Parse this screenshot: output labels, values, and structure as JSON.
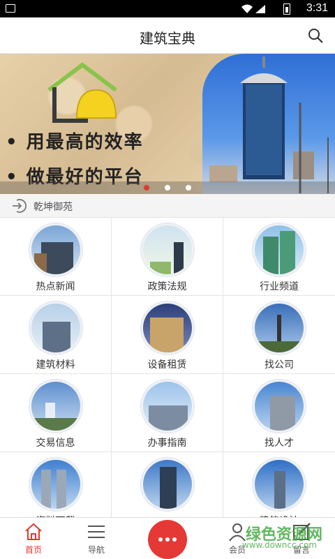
{
  "status_bar": {
    "time": "3:31"
  },
  "app_bar": {
    "title": "建筑宝典"
  },
  "banner": {
    "line1": "• 用最高的效率",
    "line2": "• 做最好的平台",
    "page_count": 3,
    "active_page": 1
  },
  "section": {
    "label": "乾坤御苑"
  },
  "grid": {
    "items": [
      {
        "label": "热点新闻",
        "icon": "news-building-icon"
      },
      {
        "label": "政策法规",
        "icon": "policy-icon"
      },
      {
        "label": "行业频道",
        "icon": "industry-icon"
      },
      {
        "label": "建筑材料",
        "icon": "materials-icon"
      },
      {
        "label": "设备租赁",
        "icon": "equipment-icon"
      },
      {
        "label": "找公司",
        "icon": "company-icon"
      },
      {
        "label": "交易信息",
        "icon": "trade-icon"
      },
      {
        "label": "办事指南",
        "icon": "guide-icon"
      },
      {
        "label": "找人才",
        "icon": "talent-icon"
      },
      {
        "label": "资料下载",
        "icon": "download-icon"
      },
      {
        "label": "",
        "icon": "tower-icon"
      },
      {
        "label": "建筑设计",
        "icon": "design-icon"
      }
    ]
  },
  "tab_bar": {
    "tabs": [
      {
        "label": "首页",
        "icon": "home-icon",
        "active": true
      },
      {
        "label": "导航",
        "icon": "menu-icon",
        "active": false
      },
      {
        "label": "会员",
        "icon": "user-icon",
        "active": false
      },
      {
        "label": "留言",
        "icon": "edit-icon",
        "active": false
      }
    ],
    "fab_icon": "more-dots-icon"
  },
  "watermark": {
    "text": "绿色资源网",
    "url": "www.downcc.com"
  },
  "colors": {
    "accent": "#e13b2e",
    "fab": "#e53935"
  }
}
